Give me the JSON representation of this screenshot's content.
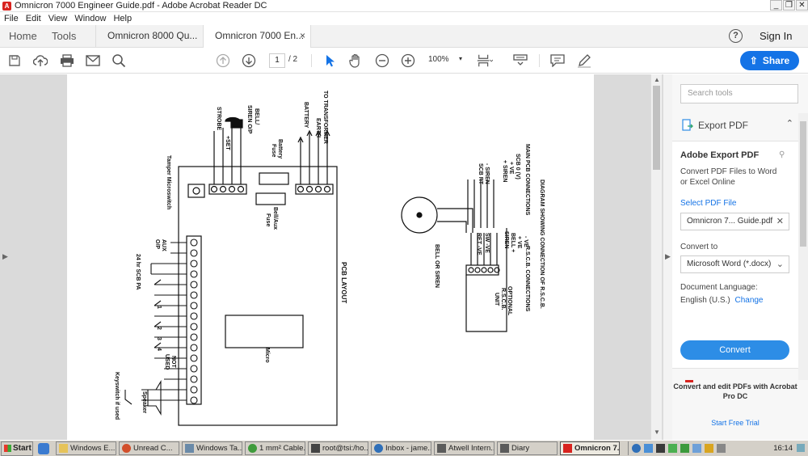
{
  "window": {
    "title": "Omnicron 7000 Engineer Guide.pdf - Adobe Acrobat Reader DC",
    "app_icon_letter": "A",
    "min": "_",
    "restore": "❐",
    "close": "✕"
  },
  "menu": [
    "File",
    "Edit",
    "View",
    "Window",
    "Help"
  ],
  "tabs": {
    "home": "Home",
    "tools": "Tools",
    "doc1": "Omnicron 8000 Qu...",
    "doc2": "Omnicron 7000 En...",
    "close": "×",
    "help": "?",
    "signin": "Sign In"
  },
  "toolbar": {
    "page_current": "1",
    "page_total": "/ 2",
    "zoom": "100%",
    "zoom_caret": "▾",
    "share": "Share",
    "share_icon": "⇧"
  },
  "doc": {
    "left_arrow": "▶",
    "scroll_up": "▲",
    "scroll_down": "▼",
    "labels": {
      "transformer": "TO TRANSFORMER",
      "earth": "EARTH",
      "battery": "BATTERY",
      "plus": "+",
      "minus": "-",
      "bell_siren": "BELL/",
      "siren_op": "SIREN O/P",
      "strobe": "STROBE",
      "set": "+SET",
      "battery_fuse_1": "Battery",
      "battery_fuse_2": "Fuse",
      "bellaux_fuse_1": "Bell/Aux",
      "bellaux_fuse_2": "Fuse",
      "tamper": "Tamper Microswitch",
      "aux_1": "AUX",
      "aux_2": "O/P",
      "scb_pa": "24 hr SCB PA",
      "not_used_1": "NOT",
      "not_used_2": "USED",
      "keyswitch": "Keyswitch if used",
      "speaker": "Speaker",
      "micro": "Micro",
      "pcb_layout": "PCB LAYOUT",
      "rscb_title": "DIAGRAM SHOWING CONNECTION OF R.S.C.B.",
      "main_pcb": "MAIN PCB CONNECTIONS",
      "rscb_conn": "R.S.C.B. CONNECTIONS",
      "scb0v": "SCB 0 (V)",
      "plusve": "+ VE",
      "plussiren": "+ SIREN",
      "minussiren": "- SIREN",
      "scbrt": "SCB RT",
      "bell_or_siren": "BELL OR SIREN",
      "optional": "OPTIONAL",
      "rscb": "R.S.C.B.",
      "unit": "UNIT",
      "r_minusve": "- VE",
      "r_plusve": "+ VE",
      "r_bell": "BELL +",
      "r_siren": "SIREN -",
      "r_swve": "SW -VE",
      "r_retve": "RET -VE",
      "zone_labels": [
        "1",
        "2",
        "3",
        "4"
      ],
      "z": "Z",
      "n": "N",
      "o": "O",
      "e": "E"
    }
  },
  "panel": {
    "search_placeholder": "Search tools",
    "export_label": "Export PDF",
    "collapse": "⌃",
    "title": "Adobe Export PDF",
    "title_icon": "⚲",
    "description": "Convert PDF Files to Word or Excel Online",
    "select_pdf": "Select PDF File",
    "file_name": "Omnicron 7... Guide.pdf",
    "file_clear": "✕",
    "convert_to_label": "Convert to",
    "convert_to_value": "Microsoft Word (*.docx)",
    "dropdown_caret": "⌄",
    "language_label": "Document Language:",
    "language_value": "English (U.S.)",
    "change": "Change",
    "convert_button": "Convert",
    "promo": "Convert and edit PDFs with Acrobat Pro DC",
    "trial": "Start Free Trial",
    "scroll_up": "▲",
    "scroll_down": "▼"
  },
  "taskbar": {
    "start": "Start",
    "tasks": [
      {
        "label": "Windows E...",
        "icon_color": "#e6c35a"
      },
      {
        "label": "Unread C...",
        "icon_color": "#d24f2b"
      },
      {
        "label": "Windows Ta...",
        "icon_color": "#6a8aa8"
      },
      {
        "label": "1 mm² Cable...",
        "icon_color": "#3f9b3c"
      },
      {
        "label": "root@tsi:/ho...",
        "icon_color": "#444444"
      },
      {
        "label": "Inbox - jame...",
        "icon_color": "#2f6fb8"
      },
      {
        "label": "Atwell Intern...",
        "icon_color": "#5b5b5b"
      },
      {
        "label": "Diary",
        "icon_color": "#5b5b5b"
      },
      {
        "label": "Omnicron 7...",
        "icon_color": "#d8231f"
      }
    ],
    "clock": "16:14"
  }
}
